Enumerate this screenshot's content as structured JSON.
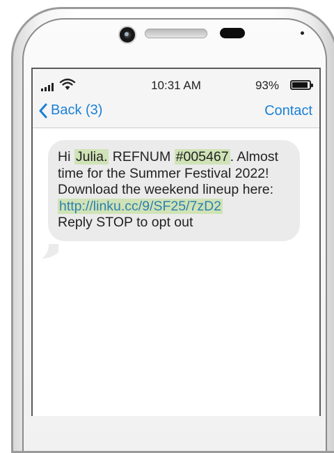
{
  "status_bar": {
    "time": "10:31 AM",
    "battery_percent": "93%",
    "icons": [
      "signal-icon",
      "wifi-icon",
      "battery-icon"
    ]
  },
  "nav": {
    "back_label": "Back (3)",
    "contact_label": "Contact"
  },
  "message": {
    "greeting": "Hi",
    "name": "Julia.",
    "ref_label": "REFNUM",
    "ref_number": "#005467",
    "ref_end": ".",
    "body": "Almost time for the Summer Festival 2022! Download the weekend lineup here:",
    "link": "http://linku.cc/9/SF25/7zD2",
    "footer": "Reply STOP to opt out"
  },
  "colors": {
    "accent": "#1a7fd6",
    "highlight": "#cfe3b6",
    "link": "#2f7fb0",
    "bubble": "#ebebeb"
  }
}
